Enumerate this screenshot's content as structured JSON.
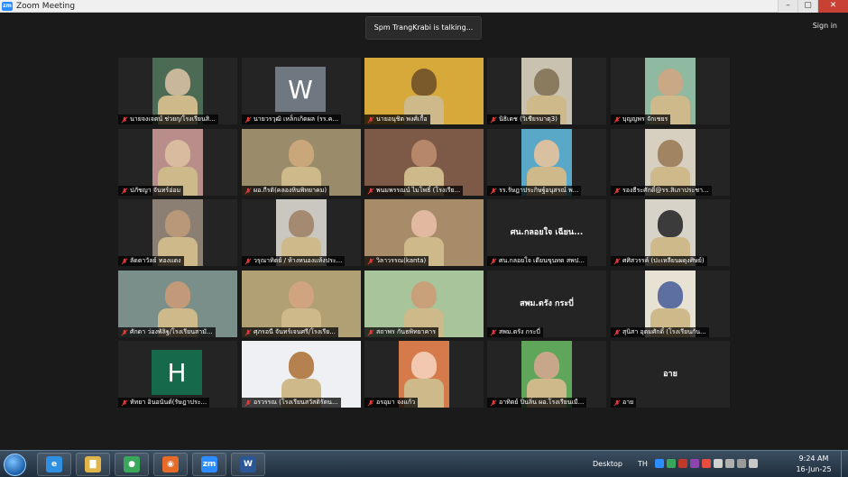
{
  "window": {
    "title": "Zoom Meeting",
    "logo_text": "zm"
  },
  "header": {
    "talking_text": "Spm TrangKrabi is talking...",
    "sign_in": "Sign in"
  },
  "participants": [
    {
      "name": "นายจงเจตน์ ช่วยกุ/โรงเรียนสิ...",
      "kind": "video",
      "bg": "#4b6b55",
      "fg": "#c8b79a"
    },
    {
      "name": "นายวรวุฒิ เหล็กเกิดผล (รร.ค...",
      "kind": "avatar",
      "letter": "W",
      "avatar_bg": "#6f7881"
    },
    {
      "name": "นายอนุชิต พงศ์เกื้อ",
      "kind": "video",
      "bg": "#d7a93a",
      "fg": "#7a5a2a",
      "speaking": true
    },
    {
      "name": "นิธิเดช (วิเชียรมาตุ3)",
      "kind": "video",
      "bg": "#c9c2b0",
      "fg": "#8a7b5e"
    },
    {
      "name": "บุญญพร จักเชยร",
      "kind": "video",
      "bg": "#8fb9a0",
      "fg": "#c9a886"
    },
    {
      "name": "ปภัชญา จันทร์อ่อม",
      "kind": "video",
      "bg": "#b98d8a",
      "fg": "#d9bca0"
    },
    {
      "name": "ผอ.กีรติ(คลองหินพิทยาคม)",
      "kind": "video",
      "bg": "#9a8c6a",
      "fg": "#c9a77a"
    },
    {
      "name": "พนมพรรณน์ ไมโพธิ์ (โรงเรีย...",
      "kind": "video",
      "bg": "#7d5a48",
      "fg": "#b7876a"
    },
    {
      "name": "รร.รัษฎาประกิษฐ์อนุสรณ์ พ...",
      "kind": "video",
      "bg": "#5aa8c8",
      "fg": "#d8c0a0"
    },
    {
      "name": "รองธีระศักดิ์@รร.สิเภาประชา...",
      "kind": "video",
      "bg": "#d7d0c0",
      "fg": "#a18563"
    },
    {
      "name": "ลัดดาวัลย์ ทองแดง",
      "kind": "video",
      "bg": "#8a7f72",
      "fg": "#b99879"
    },
    {
      "name": "วรุณาทิตย์ / ห้างหนองแห้งประ...",
      "kind": "video",
      "bg": "#c9c7c0",
      "fg": "#a58a72"
    },
    {
      "name": "วิลาวรรณ(kanta)",
      "kind": "video",
      "bg": "#a88c6a",
      "fg": "#e0b9a0"
    },
    {
      "name": "ศน.กลอยใจ เดียนขุนทด สพป...",
      "kind": "name",
      "center": "ศน.กลอยใจ เฉียน..."
    },
    {
      "name": "ศศิสวรรค์ (ปะเหลียนผดุงศิษย์)",
      "kind": "video",
      "bg": "#d8d3c8",
      "fg": "#3b3b3b"
    },
    {
      "name": "ศักดา ว่องพัลิฐ/โรงเรียนสามั...",
      "kind": "video",
      "bg": "#7b8f8a",
      "fg": "#c29a7a"
    },
    {
      "name": "ศุภรอนี จันทร์เจนศรี/โรงเรีย...",
      "kind": "video",
      "bg": "#b0a074",
      "fg": "#d0a47e"
    },
    {
      "name": "สถาพร กันธพิทยาคาร",
      "kind": "video",
      "bg": "#a8c49a",
      "fg": "#c8a07a"
    },
    {
      "name": "สพม.ตรัง กระบี่",
      "kind": "name",
      "center": "สพม.ตรัง กระบี่"
    },
    {
      "name": "สุนิสา อุดมศักดิ์ (โรงเรียนกัน...",
      "kind": "video",
      "bg": "#e7e2d4",
      "fg": "#5c6fa0"
    },
    {
      "name": "หัทยา อินอนันต์(รัษฎาประ...",
      "kind": "avatar",
      "letter": "H",
      "avatar_bg": "#16694a"
    },
    {
      "name": "อรวรรณ (โรงเรียนสวัสดิรัตน...",
      "kind": "video",
      "bg": "#eef0f4",
      "fg": "#b5814f"
    },
    {
      "name": "อรอุมา จงแก้ว",
      "kind": "video",
      "bg": "#d57a4a",
      "fg": "#f2c8b0"
    },
    {
      "name": "อาทิตย์ ปิ่นลิ่น ผอ.โรงเรียนเมื...",
      "kind": "video",
      "bg": "#5fa65a",
      "fg": "#c8a68a"
    },
    {
      "name": "อาย",
      "kind": "name",
      "center": "อาย"
    }
  ],
  "taskbar": {
    "desktop_label": "Desktop",
    "lang": "TH",
    "time": "9:24 AM",
    "date": "16-Jun-25",
    "apps": [
      {
        "name": "ie",
        "label": "e",
        "color": "#2f8fe0"
      },
      {
        "name": "explorer",
        "label": "▇",
        "color": "#e1b54a"
      },
      {
        "name": "chrome",
        "label": "●",
        "color": "#3aa85a"
      },
      {
        "name": "firefox",
        "label": "◉",
        "color": "#e66a2a"
      },
      {
        "name": "zoom",
        "label": "zm",
        "color": "#2d8cff"
      },
      {
        "name": "word",
        "label": "W",
        "color": "#2b5797"
      }
    ]
  }
}
